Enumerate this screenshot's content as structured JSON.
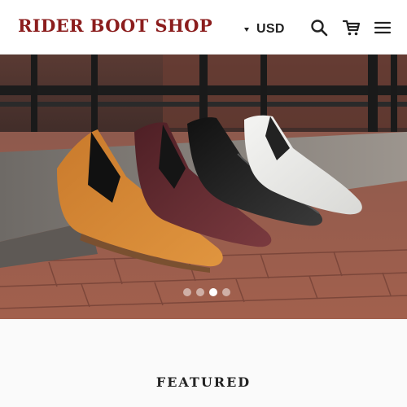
{
  "header": {
    "logo_text": "RIDER BOOT SHOP",
    "currency": {
      "code": "USD"
    },
    "icons": {
      "search": "search-icon",
      "cart": "cart-icon",
      "menu": "menu-icon"
    }
  },
  "hero": {
    "slide_count": 4,
    "active_slide": 3
  },
  "sections": {
    "featured_heading": "FEATURED"
  },
  "colors": {
    "brand": "#8b1d1d",
    "background": "#fafafa"
  }
}
